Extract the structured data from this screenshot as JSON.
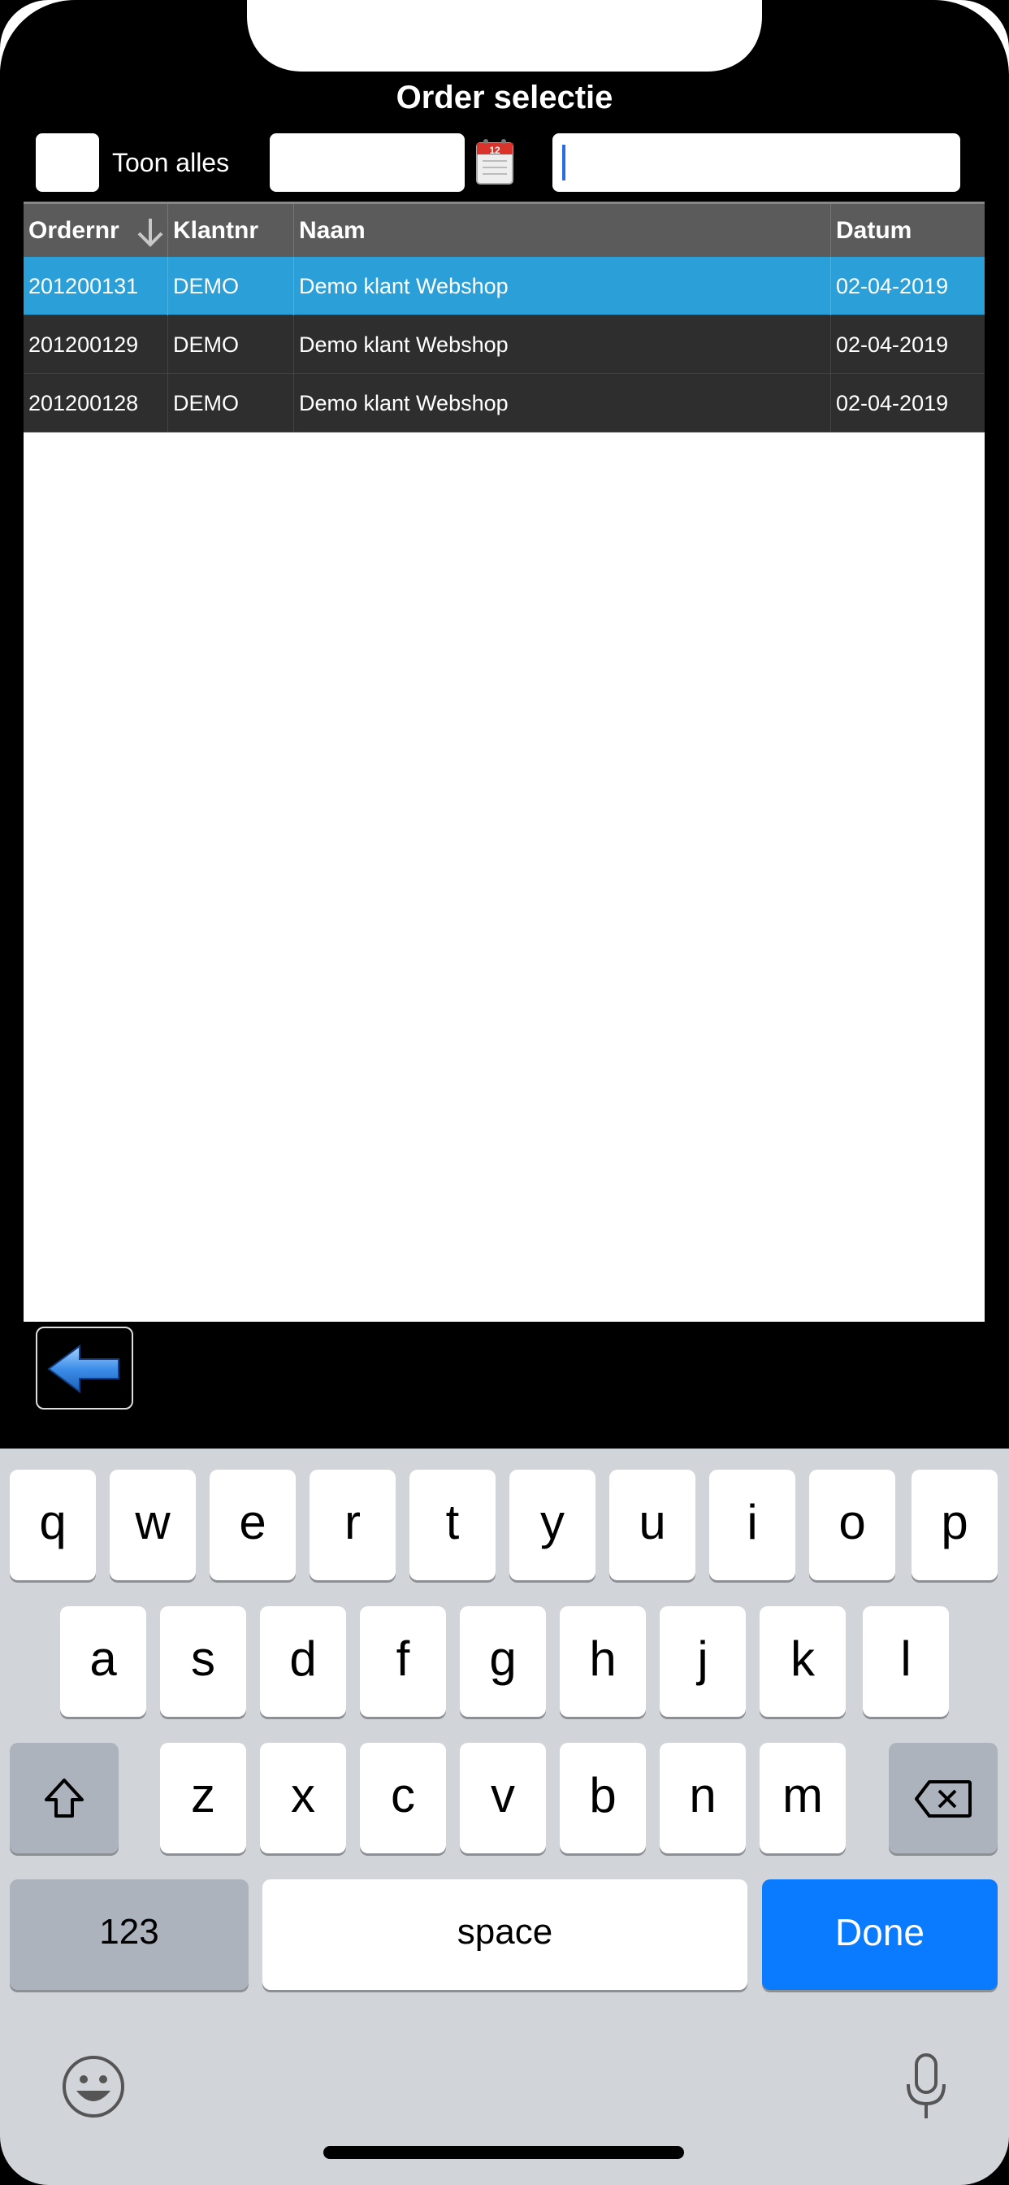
{
  "title": "Order selectie",
  "toolbar": {
    "show_all_label": "Toon alles",
    "date_value": "",
    "search_value": ""
  },
  "grid": {
    "columns": [
      "Ordernr",
      "Klantnr",
      "Naam",
      "Datum"
    ],
    "rows": [
      {
        "ordernr": "201200131",
        "klantnr": "DEMO",
        "naam": "Demo klant Webshop",
        "datum": "02-04-2019"
      },
      {
        "ordernr": "201200129",
        "klantnr": "DEMO",
        "naam": "Demo klant Webshop",
        "datum": "02-04-2019"
      },
      {
        "ordernr": "201200128",
        "klantnr": "DEMO",
        "naam": "Demo klant Webshop",
        "datum": "02-04-2019"
      }
    ]
  },
  "keyboard": {
    "row1": [
      "q",
      "w",
      "e",
      "r",
      "t",
      "y",
      "u",
      "i",
      "o",
      "p"
    ],
    "row2": [
      "a",
      "s",
      "d",
      "f",
      "g",
      "h",
      "j",
      "k",
      "l"
    ],
    "row3": [
      "z",
      "x",
      "c",
      "v",
      "b",
      "n",
      "m"
    ],
    "numbers_label": "123",
    "space_label": "space",
    "done_label": "Done"
  },
  "colors": {
    "selected_row": "#2a9fd8",
    "done_key": "#0a7aff"
  }
}
